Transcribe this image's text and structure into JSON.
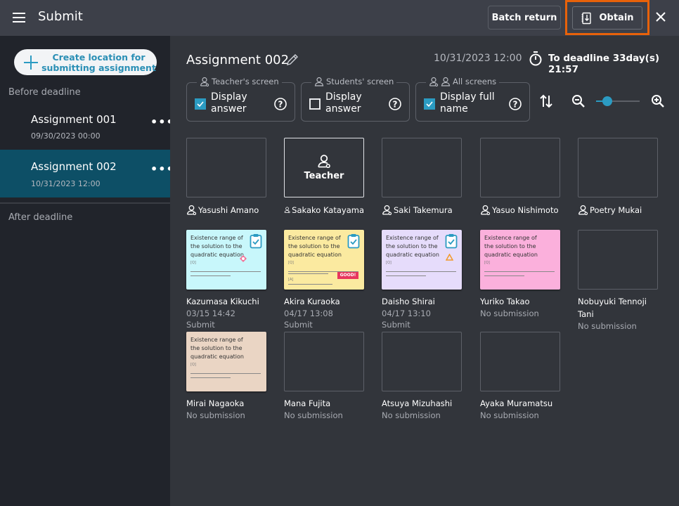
{
  "header": {
    "title": "Submit",
    "batch_return_label": "Batch return",
    "obtain_label": "Obtain",
    "highlight_color": "#e8620a"
  },
  "sidebar": {
    "create_button_label_line1": "Create location for",
    "create_button_label_line2": "submitting assignment",
    "before_deadline_label": "Before deadline",
    "after_deadline_label": "After deadline",
    "assignments": [
      {
        "name": "Assignment 001",
        "date": "09/30/2023 00:00",
        "selected": false
      },
      {
        "name": "Assignment 002",
        "date": "10/31/2023 12:00",
        "selected": true
      }
    ]
  },
  "main": {
    "assignment_title": "Assignment 002",
    "deadline_date": "10/31/2023 12:00",
    "to_deadline": "To deadline 33day(s) 21:57",
    "options": [
      {
        "legend": "Teacher's screen",
        "label_line1": "Display",
        "label_line2": "answer",
        "checked": true
      },
      {
        "legend": "Students' screen",
        "label_line1": "Display",
        "label_line2": "answer",
        "checked": false
      },
      {
        "legend": "All screens",
        "label_line1": "Display full",
        "label_line2": "name",
        "checked": true
      }
    ],
    "zoom_level_fraction": 0.25,
    "teacher_tile_label": "Teacher",
    "sheet_text": "Existence range of the solution to the quadratic equation",
    "teachers": [
      {
        "name": "Yasushi Amano",
        "is_current": false
      },
      {
        "name": "Sakako Katayama",
        "is_current": true
      },
      {
        "name": "Saki Takemura",
        "is_current": false
      },
      {
        "name": "Yasuo Nishimoto",
        "is_current": false
      },
      {
        "name": "Poetry Mukai",
        "is_current": false
      }
    ],
    "students": [
      {
        "name": "Kazumasa Kikuchi",
        "status": "03/15 14:42 Submit",
        "sheet_color": "#c8f7fb",
        "stamp": "diamond",
        "clipboard": true
      },
      {
        "name": "Akira Kuraoka",
        "status": "04/17 13:08 Submit",
        "sheet_color": "#fbeaa0",
        "stamp": "GOOD!",
        "clipboard": true
      },
      {
        "name": "Daisho Shirai",
        "status": "04/17 13:10 Submit",
        "sheet_color": "#e6dcfb",
        "stamp": "triangle",
        "clipboard": true
      },
      {
        "name": "Yuriko Takao",
        "status": "No submission",
        "sheet_color": "#fbb0dc",
        "stamp": "",
        "clipboard": false
      },
      {
        "name": "Nobuyuki Tennoji Tani",
        "status": "No submission",
        "sheet_color": "",
        "stamp": "",
        "clipboard": false
      },
      {
        "name": "Mirai Nagaoka",
        "status": "No submission",
        "sheet_color": "#ead5c4",
        "stamp": "",
        "clipboard": false
      },
      {
        "name": "Mana Fujita",
        "status": "No submission",
        "sheet_color": "",
        "stamp": "",
        "clipboard": false
      },
      {
        "name": "Atsuya Mizuhashi",
        "status": "No submission",
        "sheet_color": "",
        "stamp": "",
        "clipboard": false
      },
      {
        "name": "Ayaka Muramatsu",
        "status": "No submission",
        "sheet_color": "",
        "stamp": "",
        "clipboard": false
      }
    ]
  }
}
